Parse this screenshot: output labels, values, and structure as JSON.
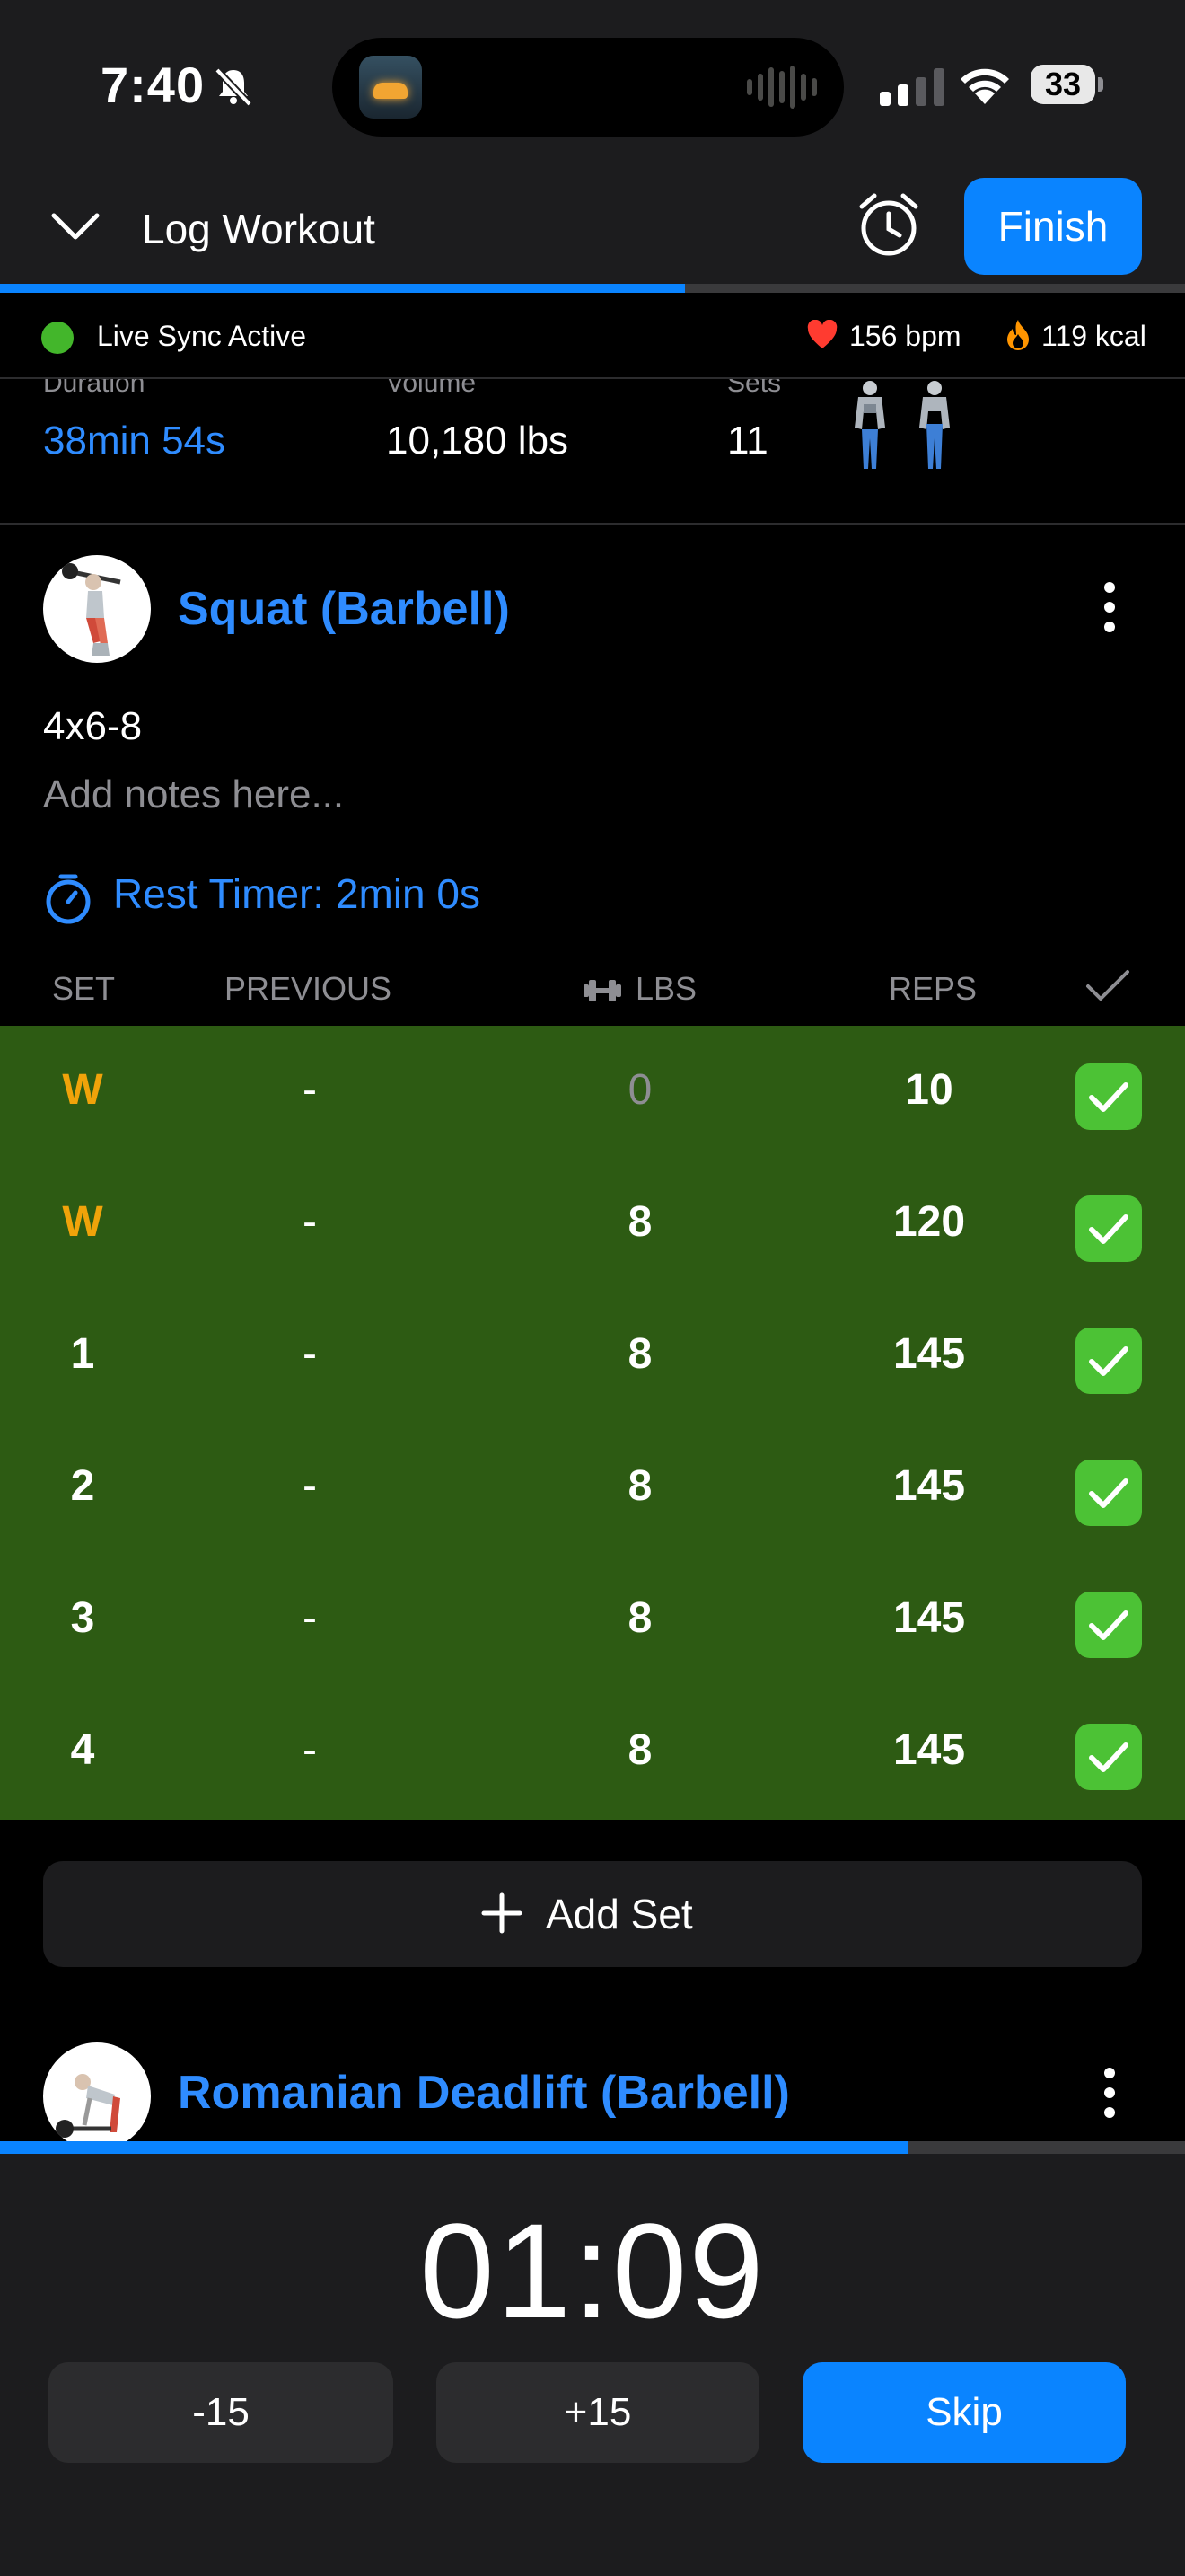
{
  "status_bar": {
    "time": "7:40",
    "battery": "33"
  },
  "header": {
    "title": "Log Workout",
    "finish_label": "Finish",
    "progress": 0.578
  },
  "live": {
    "status": "Live Sync Active",
    "heart_rate": "156 bpm",
    "calories": "119 kcal"
  },
  "stats": {
    "duration_label": "Duration",
    "duration_value": "38min 54s",
    "volume_label": "Volume",
    "volume_value": "10,180 lbs",
    "sets_label": "Sets",
    "sets_value": "11"
  },
  "exercise": {
    "name": "Squat (Barbell)",
    "note": "4x6-8",
    "notes_placeholder": "Add notes here...",
    "rest_timer": "Rest Timer: 2min 0s"
  },
  "table": {
    "headers": {
      "set": "SET",
      "previous": "PREVIOUS",
      "lbs": "LBS",
      "reps": "REPS"
    },
    "rows": [
      {
        "set": "W",
        "previous": "-",
        "lbs": "0",
        "reps": "10",
        "done": true
      },
      {
        "set": "W",
        "previous": "-",
        "lbs": "8",
        "reps": "120",
        "done": true
      },
      {
        "set": "1",
        "previous": "-",
        "lbs": "8",
        "reps": "145",
        "done": true
      },
      {
        "set": "2",
        "previous": "-",
        "lbs": "8",
        "reps": "145",
        "done": true
      },
      {
        "set": "3",
        "previous": "-",
        "lbs": "8",
        "reps": "145",
        "done": true
      },
      {
        "set": "4",
        "previous": "-",
        "lbs": "8",
        "reps": "145",
        "done": true
      }
    ]
  },
  "add_set_label": "Add Set",
  "next_exercise": {
    "name": "Romanian Deadlift (Barbell)"
  },
  "rest": {
    "time": "01:09",
    "progress": 0.766,
    "minus_label": "-15",
    "plus_label": "+15",
    "skip_label": "Skip"
  },
  "colors": {
    "accent": "#0a84ff",
    "completed_row": "#2d5b13",
    "check_green": "#4cc235",
    "warmup": "#f0a30a"
  }
}
